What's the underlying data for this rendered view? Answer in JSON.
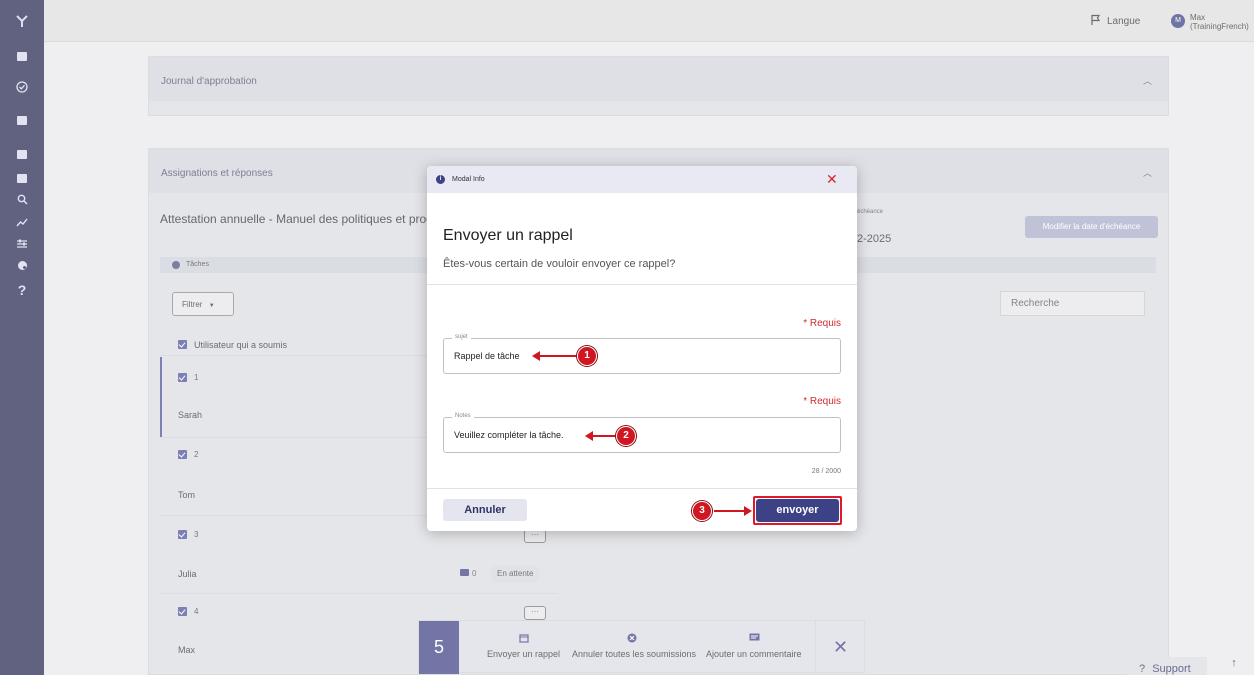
{
  "topbar": {
    "language": "Langue",
    "avatar_initial": "M",
    "user_line1": "Max",
    "user_line2": "(TrainingFrench)"
  },
  "rail": {
    "icons": [
      "logo-icon",
      "dashboard-icon",
      "check-circle-icon",
      "chat-icon",
      "report-icon",
      "library-icon",
      "search-icon",
      "trend-icon",
      "sliders-icon",
      "palette-icon",
      "help-icon"
    ],
    "help_glyph": "?"
  },
  "approval_card": {
    "title": "Journal d'approbation"
  },
  "assign_card": {
    "title": "Assignations et réponses",
    "doc_title": "Attestation annuelle - Manuel des politiques et proc",
    "due_label": "échéance",
    "due_value": "2-2025",
    "due_button": "Modifier la date d'échéance"
  },
  "tasks_panel": {
    "label": "Tâches",
    "filter_label": "Filtrer",
    "search_placeholder": "Recherche",
    "header": "Utilisateur qui a soumis",
    "rows": [
      {
        "num": "1",
        "name": "Sarah"
      },
      {
        "num": "2",
        "name": "Tom"
      },
      {
        "num": "3",
        "name": "Julia",
        "comments": "0",
        "status": "En attente"
      },
      {
        "num": "4",
        "name": "Max"
      }
    ],
    "more_glyph": "···"
  },
  "action_bar": {
    "count": "5",
    "actions": [
      "Envoyer un rappel",
      "Annuler toutes les soumissions",
      "Ajouter un commentaire"
    ],
    "close_glyph": "✕"
  },
  "support": {
    "label": "Support",
    "help_glyph": "?",
    "up_glyph": "↑"
  },
  "modal": {
    "header": "Modal Info",
    "info_glyph": "i",
    "close_glyph": "✕",
    "title": "Envoyer un rappel",
    "subtitle": "Êtes-vous certain de vouloir envoyer ce rappel?",
    "required": "* Requis",
    "subject_label": "sujet",
    "subject_value": "Rappel de tâche",
    "notes_label": "Notes",
    "notes_value": "Veuillez compléter la tâche.",
    "counter": "28 / 2000",
    "cancel": "Annuler",
    "send": "envoyer"
  },
  "annotations": [
    "1",
    "2",
    "3"
  ],
  "colors": {
    "primary": "#3d4186",
    "danger": "#d01620",
    "rail": "#23264f"
  }
}
